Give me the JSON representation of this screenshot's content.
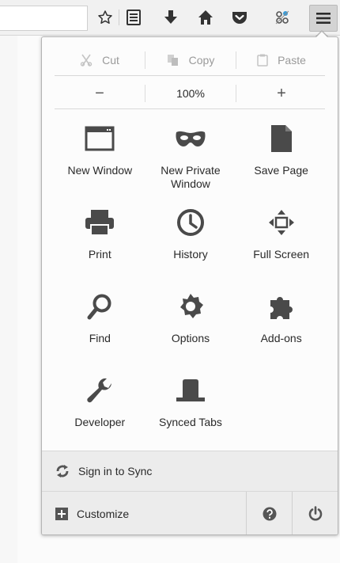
{
  "edit": {
    "cut": "Cut",
    "copy": "Copy",
    "paste": "Paste"
  },
  "zoom": {
    "minus": "−",
    "level": "100%",
    "plus": "+"
  },
  "tiles": [
    {
      "label": "New Window",
      "icon": "new-window-icon"
    },
    {
      "label": "New Private\nWindow",
      "icon": "private-mask-icon"
    },
    {
      "label": "Save Page",
      "icon": "save-page-icon"
    },
    {
      "label": "Print",
      "icon": "printer-icon"
    },
    {
      "label": "History",
      "icon": "clock-icon"
    },
    {
      "label": "Full Screen",
      "icon": "fullscreen-icon"
    },
    {
      "label": "Find",
      "icon": "magnifier-icon"
    },
    {
      "label": "Options",
      "icon": "gear-icon"
    },
    {
      "label": "Add-ons",
      "icon": "puzzle-icon"
    },
    {
      "label": "Developer",
      "icon": "wrench-icon"
    },
    {
      "label": "Synced Tabs",
      "icon": "synced-tabs-icon"
    }
  ],
  "footer": {
    "sync_label": "Sign in to Sync",
    "customize_label": "Customize"
  },
  "colors": {
    "icon": "#4a4a4a",
    "muted": "#9a9a9a",
    "panel_bg": "#fcfcfc",
    "footer_bg": "#ececec"
  }
}
